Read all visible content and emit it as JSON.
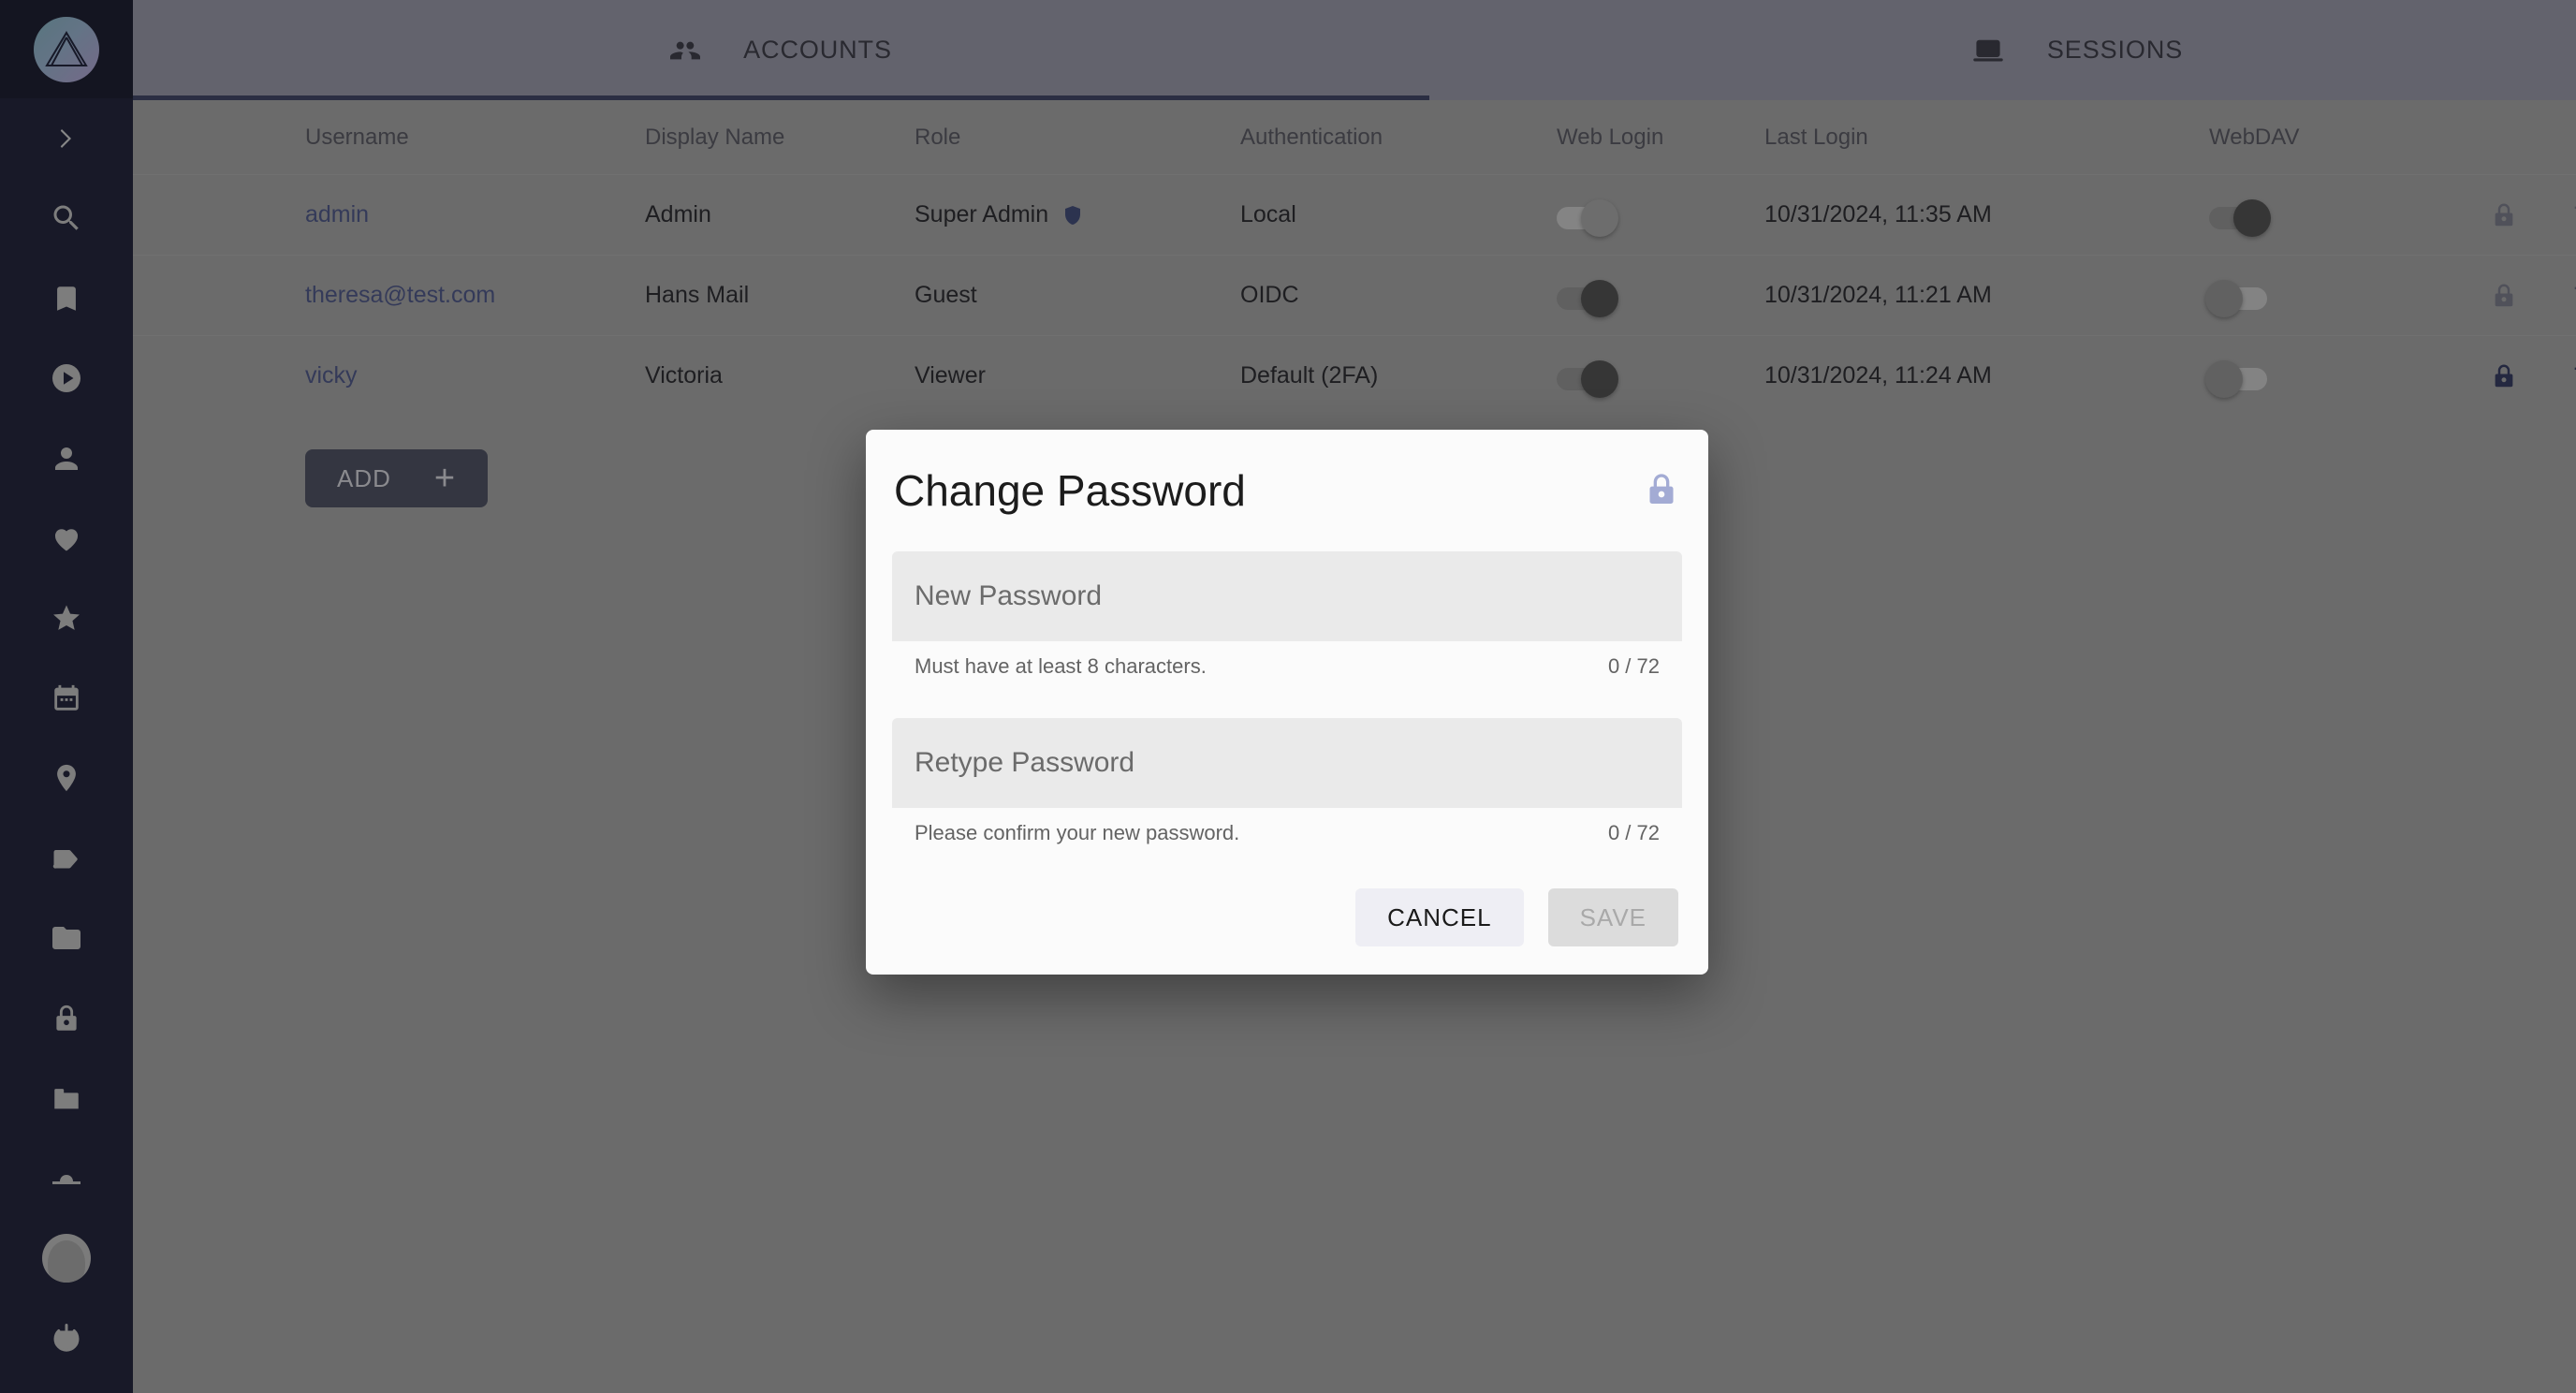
{
  "sidebar": {
    "logo_icon": "triangle-logo-icon",
    "items": [
      {
        "icon": "chevron-right-icon",
        "name": "expand-sidebar"
      },
      {
        "icon": "search-icon",
        "name": "search"
      },
      {
        "icon": "bookmark-icon",
        "name": "bookmarks"
      },
      {
        "icon": "play-circle-icon",
        "name": "media"
      },
      {
        "icon": "person-icon",
        "name": "people"
      },
      {
        "icon": "heart-icon",
        "name": "favorites"
      },
      {
        "icon": "star-icon",
        "name": "starred"
      },
      {
        "icon": "calendar-icon",
        "name": "calendar"
      },
      {
        "icon": "location-pin-icon",
        "name": "places"
      },
      {
        "icon": "tag-icon",
        "name": "tags"
      },
      {
        "icon": "folder-icon",
        "name": "folders"
      },
      {
        "icon": "lock-icon",
        "name": "locked"
      },
      {
        "icon": "archive-icon",
        "name": "archive"
      },
      {
        "icon": "trash-icon",
        "name": "trash"
      }
    ],
    "avatar_icon": "user-avatar",
    "power_icon": "power-icon"
  },
  "tabs": [
    {
      "label": "ACCOUNTS",
      "icon": "people-icon",
      "active": true
    },
    {
      "label": "SESSIONS",
      "icon": "laptop-icon",
      "active": false
    }
  ],
  "table": {
    "columns": [
      "Username",
      "Display Name",
      "Role",
      "Authentication",
      "Web Login",
      "Last Login",
      "WebDAV"
    ],
    "rows": [
      {
        "username": "admin",
        "display_name": "Admin",
        "role": "Super Admin",
        "role_badge_icon": "shield-icon",
        "authentication": "Local",
        "web_login": true,
        "web_login_style": "faint",
        "last_login": "10/31/2024, 11:35 AM",
        "webdav": true,
        "webdav_style": "strong",
        "actions_opacity": "op-35"
      },
      {
        "username": "theresa@test.com",
        "display_name": "Hans Mail",
        "role": "Guest",
        "role_badge_icon": "",
        "authentication": "OIDC",
        "web_login": true,
        "web_login_style": "strong",
        "last_login": "10/31/2024, 11:21 AM",
        "webdav": false,
        "webdav_style": "",
        "actions_opacity": "op-55"
      },
      {
        "username": "vicky",
        "display_name": "Victoria",
        "role": "Viewer",
        "role_badge_icon": "",
        "authentication": "Default (2FA)",
        "web_login": true,
        "web_login_style": "strong",
        "last_login": "10/31/2024, 11:24 AM",
        "webdav": false,
        "webdav_style": "",
        "actions_opacity": "op-100"
      }
    ],
    "row_actions": [
      "change-password-lock-icon",
      "delete-trash-icon",
      "edit-pencil-icon"
    ]
  },
  "add_button": {
    "label": "ADD",
    "plus": "+"
  },
  "dialog": {
    "title": "Change Password",
    "lock_icon": "lock-icon",
    "new_password": {
      "placeholder": "New Password",
      "value": "",
      "helper": "Must have at least 8 characters.",
      "counter": "0 / 72"
    },
    "retype_password": {
      "placeholder": "Retype Password",
      "value": "",
      "helper": "Please confirm your new password.",
      "counter": "0 / 72"
    },
    "cancel_label": "CANCEL",
    "save_label": "SAVE"
  },
  "colors": {
    "sidebar_bg": "#23253a",
    "header_bg": "#8f8f9c",
    "content_bg": "#9a9a9a",
    "accent": "#3e4260",
    "link": "#4b5480",
    "dialog_bg": "#fbfbfb",
    "lock_accent": "#a3abd4"
  }
}
